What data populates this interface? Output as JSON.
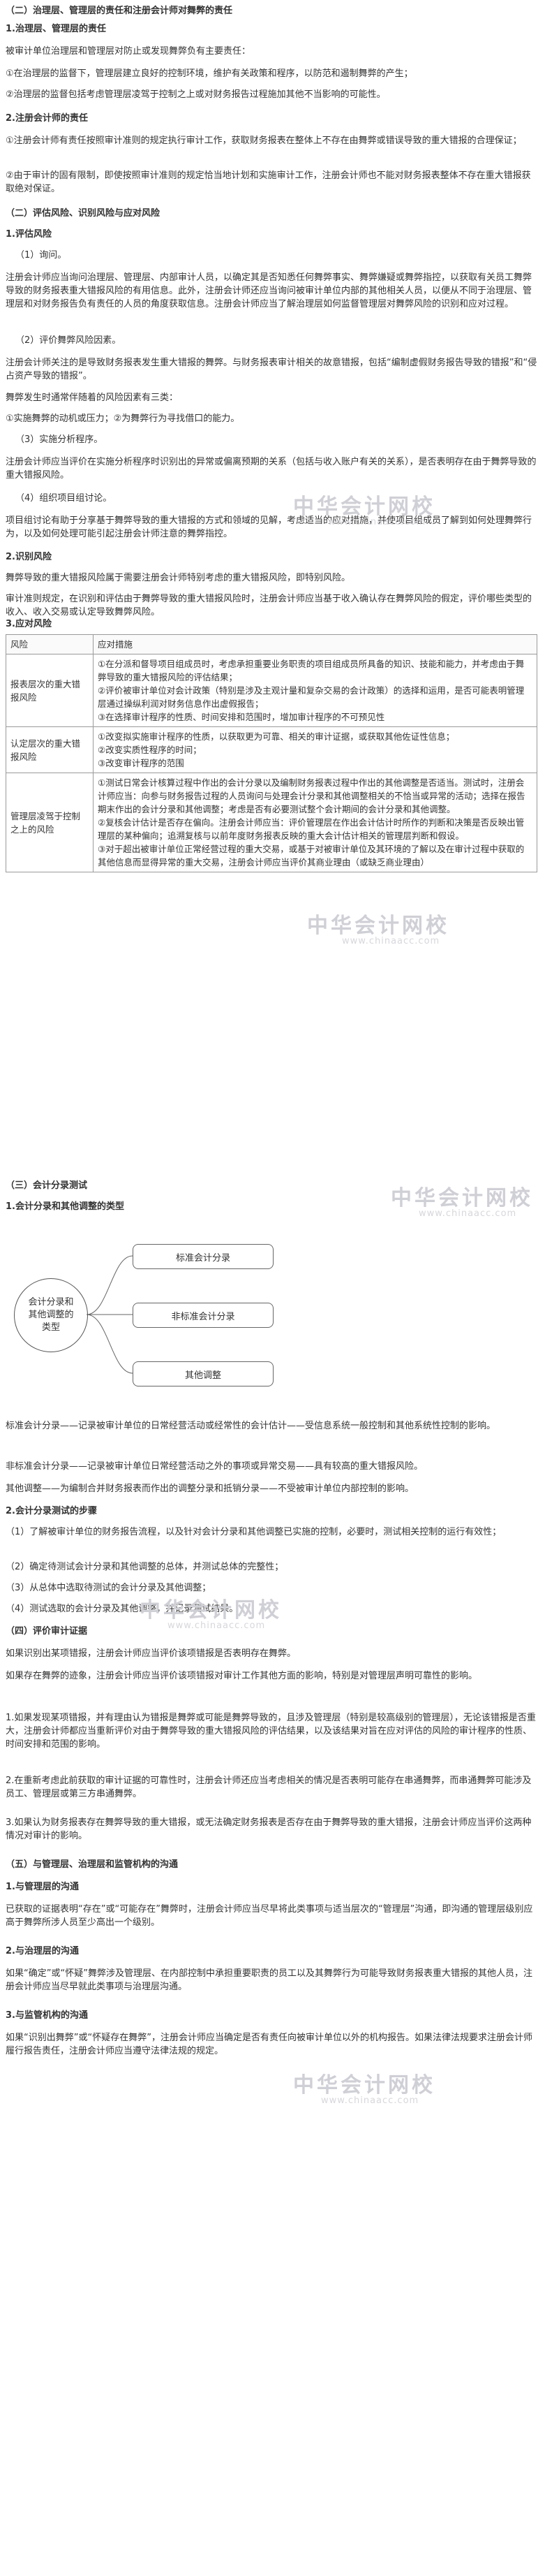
{
  "doc": {
    "sec1_title": "（二）治理层、管理层的责任和注册会计师对舞弊的责任",
    "s1_1_title": "1.治理层、管理层的责任",
    "s1_1_p1": "被审计单位治理层和管理层对防止或发现舞弊负有主要责任：",
    "s1_1_p2": "①在治理层的监督下，管理层建立良好的控制环境，维护有关政策和程序，以防范和遏制舞弊的产生；",
    "s1_1_p3": "②治理层的监督包括考虑管理层凌驾于控制之上或对财务报告过程施加其他不当影响的可能性。",
    "s1_2_title": "2.注册会计师的责任",
    "s1_2_p1": "①注册会计师有责任按照审计准则的规定执行审计工作，获取财务报表在整体上不存在由舞弊或错误导致的重大错报的合理保证；",
    "s1_2_p2": "②由于审计的固有限制，即使按照审计准则的规定恰当地计划和实施审计工作，注册会计师也不能对财务报表整体不存在重大错报获取绝对保证。",
    "sec2_title": "（二）评估风险、识别风险与应对风险",
    "s2_1_title": "1.评估风险",
    "s2_1_a": "（1）询问。",
    "s2_1_a_p": "注册会计师应当询问治理层、管理层、内部审计人员，以确定其是否知悉任何舞弊事实、舞弊嫌疑或舞弊指控，以获取有关员工舞弊导致的财务报表重大错报风险的有用信息。此外，注册会计师还应当询问被审计单位内部的其他相关人员，以便从不同于治理层、管理层和对财务报告负有责任的人员的角度获取信息。注册会计师应当了解治理层如何监督管理层对舞弊风险的识别和应对过程。",
    "s2_1_b": "（2）评价舞弊风险因素。",
    "s2_1_b_p": "注册会计师关注的是导致财务报表发生重大错报的舞弊。与财务报表审计相关的故意错报，包括“编制虚假财务报告导致的错报”和“侵占资产导致的错报”。",
    "s2_1_b_p2": "舞弊发生时通常伴随着的风险因素有三类：",
    "s2_1_b_p3": "①实施舞弊的动机或压力；②为舞弊行为寻找借口的能力。",
    "s2_1_c": "（3）实施分析程序。",
    "s2_1_c_p": "注册会计师应当评价在实施分析程序时识别出的异常或偏离预期的关系（包括与收入账户有关的关系），是否表明存在由于舞弊导致的重大错报风险。",
    "s2_1_d": "（4）组织项目组讨论。",
    "s2_1_d_p": "项目组讨论有助于分享基于舞弊导致的重大错报的方式和领域的见解，考虑适当的应对措施，并使项目组成员了解到如何处理舞弊行为，以及如何处理可能引起注册会计师注意的舞弊指控。",
    "s2_2_title": "2.识别风险",
    "s2_2_p1": "舞弊导致的重大错报风险属于需要注册会计师特别考虑的重大错报风险，即特别风险。",
    "s2_2_p2": "审计准则规定，在识别和评估由于舞弊导致的重大错报风险时，注册会计师应当基于收入确认存在舞弊风险的假定，评价哪些类型的收入、收入交易或认定导致舞弊风险。",
    "s2_3_title": "3.应对风险",
    "sec3_title": "（三）会计分录测试",
    "s3_1_title": "1.会计分录和其他调整的类型",
    "s3_p1": "标准会计分录——记录被审计单位的日常经营活动或经常性的会计估计——受信息系统一般控制和其他系统性控制的影响。",
    "s3_p2": "非标准会计分录——记录被审计单位日常经营活动之外的事项或异常交易——具有较高的重大错报风险。",
    "s3_p3": "其他调整——为编制合并财务报表而作出的调整分录和抵销分录——不受被审计单位内部控制的影响。",
    "s3_2_title": "2.会计分录测试的步骤",
    "s3_2_p1": "（1）了解被审计单位的财务报告流程，以及针对会计分录和其他调整已实施的控制，必要时，测试相关控制的运行有效性；",
    "s3_2_p2": "（2）确定待测试会计分录和其他调整的总体，并测试总体的完整性；",
    "s3_2_p3": "（3）从总体中选取待测试的会计分录及其他调整；",
    "s3_2_p4": "（4）测试选取的会计分录及其他调整，并记录测试结果。",
    "sec4_title": "（四）评价审计证据",
    "s4_p1": "如果识别出某项错报，注册会计师应当评价该项错报是否表明存在舞弊。",
    "s4_p2": "如果存在舞弊的迹象，注册会计师应当评价该项错报对审计工作其他方面的影响，特别是对管理层声明可靠性的影响。",
    "s4_p3": "1.如果发现某项错报，并有理由认为错报是舞弊或可能是舞弊导致的，且涉及管理层（特别是较高级别的管理层），无论该错报是否重大，注册会计师都应当重新评价对由于舞弊导致的重大错报风险的评估结果，以及该结果对旨在应对评估的风险的审计程序的性质、时间安排和范围的影响。",
    "s4_p4": "2.在重新考虑此前获取的审计证据的可靠性时，注册会计师还应当考虑相关的情况是否表明可能存在串通舞弊，而串通舞弊可能涉及员工、管理层或第三方串通舞弊。",
    "s4_p5": "3.如果认为财务报表存在舞弊导致的重大错报，或无法确定财务报表是否存在由于舞弊导致的重大错报，注册会计师应当评价这两种情况对审计的影响。",
    "sec5_title": "（五）与管理层、治理层和监管机构的沟通",
    "s5_1_title": "1.与管理层的沟通",
    "s5_1_p": "已获取的证据表明“存在”或“可能存在”舞弊时，注册会计师应当尽早将此类事项与适当层次的“管理层”沟通，即沟通的管理层级别应高于舞弊所涉人员至少高出一个级别。",
    "s5_2_title": "2.与治理层的沟通",
    "s5_2_p": "如果“确定”或“怀疑”舞弊涉及管理层、在内部控制中承担重要职责的员工以及其舞弊行为可能导致财务报表重大错报的其他人员，注册会计师应当尽早就此类事项与治理层沟通。",
    "s5_3_title": "3.与监管机构的沟通",
    "s5_3_p": "如果“识别出舞弊”或“怀疑存在舞弊”，注册会计师应当确定是否有责任向被审计单位以外的机构报告。如果法律法规要求注册会计师履行报告责任，注册会计师应当遵守法律法规的规定。"
  },
  "table": {
    "headers": [
      "风险",
      "应对措施"
    ],
    "rows": [
      {
        "risk": "报表层次的重大错报风险",
        "measures": [
          "①在分派和督导项目组成员时，考虑承担重要业务职责的项目组成员所具备的知识、技能和能力，并考虑由于舞弊导致的重大错报风险的评估结果；",
          "②评价被审计单位对会计政策（特别是涉及主观计量和复杂交易的会计政策）的选择和运用，是否可能表明管理层通过操纵利润对财务信息作出虚假报告；",
          "③在选择审计程序的性质、时间安排和范围时，增加审计程序的不可预见性"
        ]
      },
      {
        "risk": "认定层次的重大错报风险",
        "measures": [
          "①改变拟实施审计程序的性质，以获取更为可靠、相关的审计证据，或获取其他佐证性信息；",
          "②改变实质性程序的时间；",
          "③改变审计程序的范围"
        ]
      },
      {
        "risk": "管理层凌驾于控制之上的风险",
        "measures": [
          "①测试日常会计核算过程中作出的会计分录以及编制财务报表过程中作出的其他调整是否适当。测试时，注册会计师应当：向参与财务报告过程的人员询问与处理会计分录和其他调整相关的不恰当或异常的活动；选择在报告期末作出的会计分录和其他调整；考虑是否有必要测试整个会计期间的会计分录和其他调整。",
          "②复核会计估计是否存在偏向。注册会计师应当：评价管理层在作出会计估计时所作的判断和决策是否反映出管理层的某种偏向；追溯复核与以前年度财务报表反映的重大会计估计相关的管理层判断和假设。",
          "③对于超出被审计单位正常经营过程的重大交易，或基于对被审计单位及其环境的了解以及在审计过程中获取的其他信息而显得异常的重大交易，注册会计师应当评价其商业理由（或缺乏商业理由）"
        ]
      }
    ]
  },
  "diagram": {
    "center": "会计分录和其他调整的类型",
    "boxes": [
      "标准会计分录",
      "非标准会计分录",
      "其他调整"
    ]
  },
  "watermark": {
    "big": "中华会计网校",
    "url": "www.chinaacc.com"
  },
  "colors": {
    "text": "#333333",
    "watermark": "#cfcfd6",
    "link": "#1a66cc",
    "border": "#9a9a9a"
  }
}
